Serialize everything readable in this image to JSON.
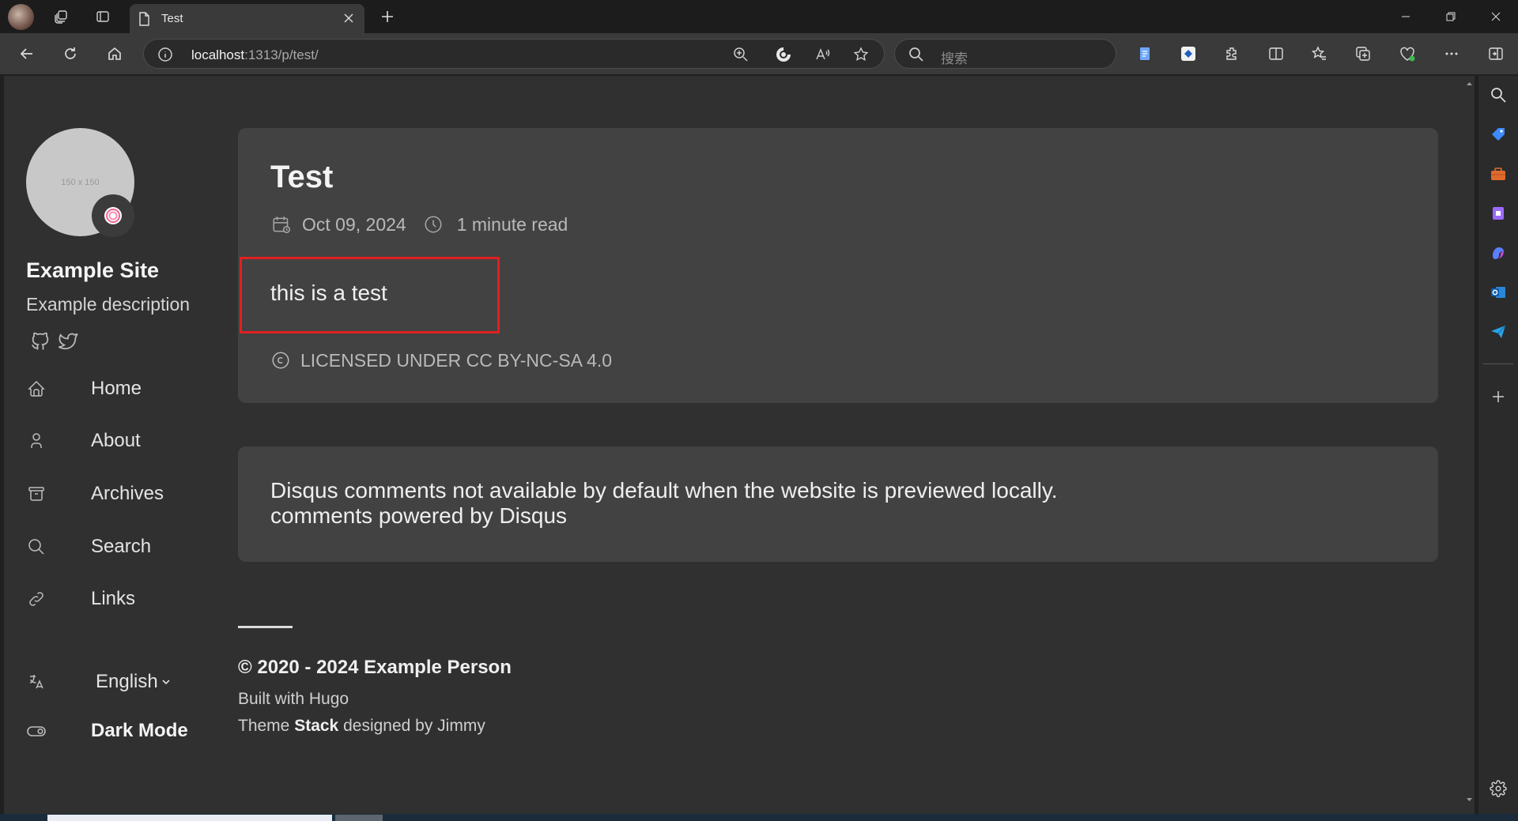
{
  "browser": {
    "tab_title": "Test",
    "url_host": "localhost",
    "url_path": ":1313/p/test/",
    "search_placeholder": "搜索"
  },
  "sidebar": {
    "avatar_placeholder": "150 x 150",
    "site_title": "Example Site",
    "site_description": "Example description",
    "menu": [
      {
        "label": "Home",
        "icon": "home-icon"
      },
      {
        "label": "About",
        "icon": "user-icon"
      },
      {
        "label": "Archives",
        "icon": "archive-icon"
      },
      {
        "label": "Search",
        "icon": "search-icon"
      },
      {
        "label": "Links",
        "icon": "link-icon"
      }
    ],
    "language": "English",
    "dark_mode": "Dark Mode"
  },
  "article": {
    "title": "Test",
    "date": "Oct 09, 2024",
    "read_time": "1 minute read",
    "body": "this is a test",
    "license": "LICENSED UNDER CC BY-NC-SA 4.0"
  },
  "comments": {
    "line1": "Disqus comments not available by default when the website is previewed locally.",
    "line2": "comments powered by Disqus"
  },
  "footer": {
    "copyright": "© 2020 - 2024 Example Person",
    "built_with": "Built with Hugo",
    "theme_prefix": "Theme ",
    "theme_name": "Stack",
    "theme_suffix": " designed by Jimmy"
  },
  "colors": {
    "highlight_border": "#e02020",
    "page_bg": "#303030",
    "card_bg": "#424242"
  }
}
